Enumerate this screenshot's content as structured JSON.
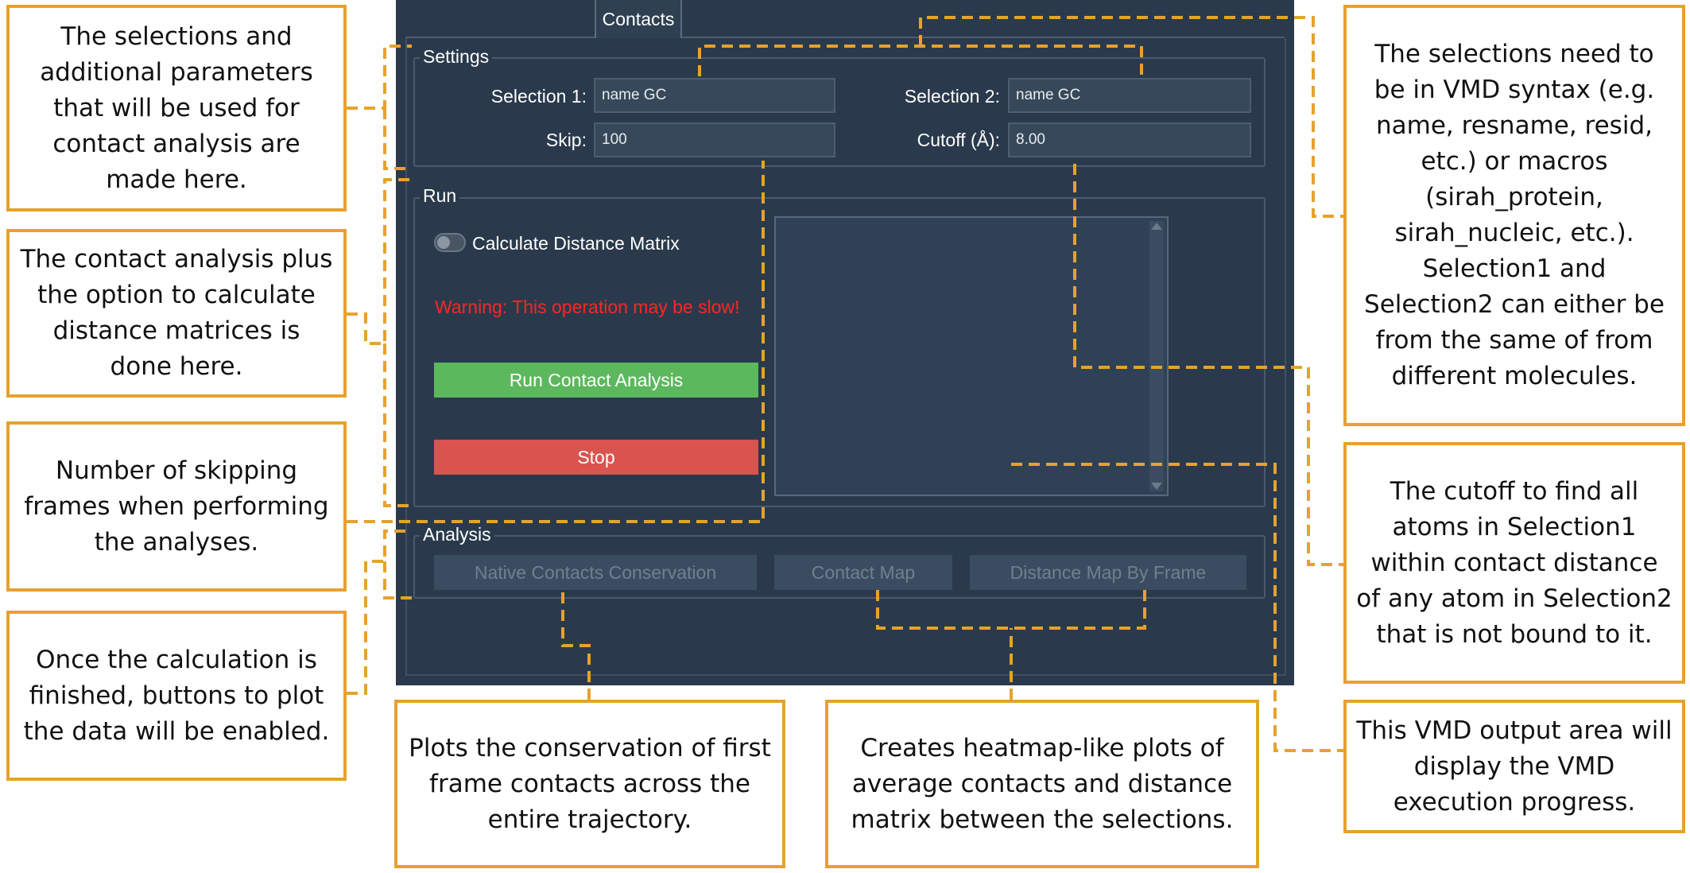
{
  "app": {
    "tab_label": "Contacts",
    "settings": {
      "title": "Settings",
      "selection1_label": "Selection 1:",
      "selection1_value": "name GC",
      "selection2_label": "Selection 2:",
      "selection2_value": "name GC",
      "skip_label": "Skip:",
      "skip_value": "100",
      "cutoff_label": "Cutoff (Å):",
      "cutoff_value": "8.00"
    },
    "run": {
      "title": "Run",
      "toggle_label": "Calculate Distance Matrix",
      "warning": "Warning: This operation may be slow!",
      "run_button": "Run Contact Analysis",
      "stop_button": "Stop"
    },
    "analysis": {
      "title": "Analysis",
      "buttons": [
        "Native Contacts Conservation",
        "Contact Map",
        "Distance Map By Frame"
      ]
    }
  },
  "callouts": {
    "settings": "The selections and additional parameters that will be used for contact analysis are made here.",
    "run": "The contact analysis plus the option to calculate distance matrices is done here.",
    "skip": "Number of skipping frames when performing the analyses.",
    "analysis": "Once the calculation is finished, buttons to plot the data will be enabled.",
    "native": "Plots the conservation of first frame contacts across the entire trajectory.",
    "heatmap": "Creates heatmap-like plots of average contacts and distance matrix between the selections.",
    "syntax": "The selections need to be in VMD syntax (e.g. name, resname, resid, etc.) or macros (sirah_protein, sirah_nucleic, etc.). Selection1 and Selection2 can either be from the same of from different molecules.",
    "cutoff": "The cutoff to find all atoms in Selection1 within contact distance of any atom in Selection2 that is not bound to it.",
    "output": "This VMD output area will display the VMD execution progress."
  },
  "colors": {
    "callout_border": "#e6a22c",
    "panel_bg": "#2a3a4c",
    "run_button": "#5cb85c",
    "stop_button": "#d9534f",
    "warning_text": "#ff2525"
  }
}
